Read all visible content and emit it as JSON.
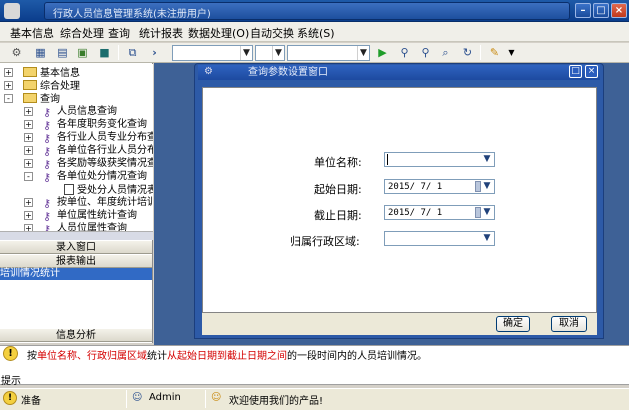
{
  "window": {
    "title": "行政人员信息管理系统(未注册用户)"
  },
  "menu": [
    "基本信息",
    "综合处理",
    "查询",
    "统计报表",
    "数据处理(O)",
    "自动交换",
    "系统(S)"
  ],
  "tree": [
    {
      "label": "基本信息",
      "level": 0,
      "type": "folder",
      "expander": "+"
    },
    {
      "label": "综合处理",
      "level": 0,
      "type": "folder",
      "expander": "+"
    },
    {
      "label": "查询",
      "level": 0,
      "type": "folder",
      "expander": "-"
    },
    {
      "label": "人员信息查询",
      "level": 1,
      "type": "node",
      "expander": "+"
    },
    {
      "label": "各年度职务变化查询",
      "level": 1,
      "type": "node",
      "expander": "+"
    },
    {
      "label": "各行业人员专业分布查",
      "level": 1,
      "type": "node",
      "expander": "+"
    },
    {
      "label": "各单位各行业人员分布",
      "level": 1,
      "type": "node",
      "expander": "+"
    },
    {
      "label": "各奖励等级获奖情况查",
      "level": 1,
      "type": "node",
      "expander": "+"
    },
    {
      "label": "各单位处分情况查询",
      "level": 1,
      "type": "node",
      "expander": "-"
    },
    {
      "label": "受处分人员情况表",
      "level": 2,
      "type": "doc",
      "expander": ""
    },
    {
      "label": "按单位、年度统计培训",
      "level": 1,
      "type": "node",
      "expander": "+"
    },
    {
      "label": "单位属性统计查询",
      "level": 1,
      "type": "node",
      "expander": "+"
    },
    {
      "label": "人员位属性查询",
      "level": 1,
      "type": "node",
      "expander": "+"
    }
  ],
  "left_sections": {
    "entry": "录入窗口",
    "report": "报表输出",
    "selected": "培训情况统计",
    "analysis": "信息分析"
  },
  "dialog": {
    "title": "查询参数设置窗口",
    "unit_label": "单位名称:",
    "unit_value": "",
    "start_label": "起始日期:",
    "start_value": "2015/ 7/ 1",
    "end_label": "截止日期:",
    "end_value": "2015/ 7/ 1",
    "region_label": "归属行政区域:",
    "region_value": "",
    "ok": "确定",
    "cancel": "取消"
  },
  "info": {
    "p1": "按",
    "p2": "单位名称、行政归属区域",
    "p3": "统计",
    "p4": "从起始日期到截止日期之间",
    "p5": "的一段时间内的人员培训情况。",
    "tip": "提示"
  },
  "status": {
    "ready": "准备",
    "user": "Admin",
    "welcome": "欢迎使用我们的产品!"
  }
}
